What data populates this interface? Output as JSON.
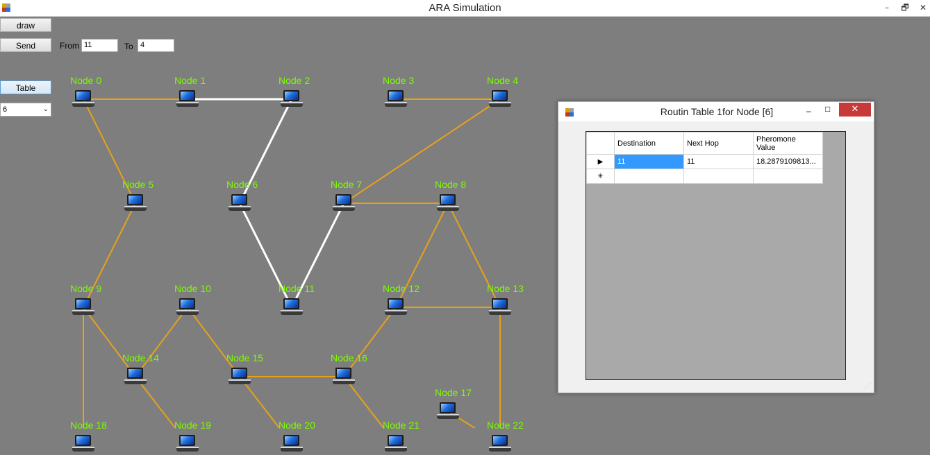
{
  "window": {
    "title": "ARA Simulation",
    "minimize": "–",
    "restore": "🗗",
    "close": "✕"
  },
  "controls": {
    "draw_label": "draw",
    "send_label": "Send",
    "from_label": "From",
    "from_value": "11",
    "to_label": "To",
    "to_value": "4",
    "table_label": "Table",
    "node_select_value": "6"
  },
  "nodes": [
    {
      "label": "Node 0"
    },
    {
      "label": "Node 1"
    },
    {
      "label": "Node 2"
    },
    {
      "label": "Node 3"
    },
    {
      "label": "Node 4"
    },
    {
      "label": "Node 5"
    },
    {
      "label": "Node 6"
    },
    {
      "label": "Node 7"
    },
    {
      "label": "Node 8"
    },
    {
      "label": "Node 9"
    },
    {
      "label": "Node 10"
    },
    {
      "label": "Node 11"
    },
    {
      "label": "Node 12"
    },
    {
      "label": "Node 13"
    },
    {
      "label": "Node 14"
    },
    {
      "label": "Node 15"
    },
    {
      "label": "Node 16"
    },
    {
      "label": "Node 17"
    },
    {
      "label": "Node 18"
    },
    {
      "label": "Node 19"
    },
    {
      "label": "Node 20"
    },
    {
      "label": "Node 21"
    },
    {
      "label": "Node 22"
    }
  ],
  "edges": [
    [
      0,
      1
    ],
    [
      1,
      2
    ],
    [
      3,
      4
    ],
    [
      0,
      5
    ],
    [
      2,
      6
    ],
    [
      4,
      7
    ],
    [
      7,
      8
    ],
    [
      5,
      9
    ],
    [
      6,
      11
    ],
    [
      7,
      11
    ],
    [
      8,
      12
    ],
    [
      8,
      13
    ],
    [
      12,
      13
    ],
    [
      9,
      14
    ],
    [
      10,
      14
    ],
    [
      9,
      18
    ],
    [
      10,
      15
    ],
    [
      15,
      16
    ],
    [
      12,
      16
    ],
    [
      14,
      19
    ],
    [
      15,
      20
    ],
    [
      16,
      21
    ],
    [
      13,
      22
    ],
    [
      17,
      22
    ]
  ],
  "path_edges": [
    [
      1,
      2
    ],
    [
      2,
      6
    ],
    [
      6,
      11
    ],
    [
      11,
      7
    ]
  ],
  "colors": {
    "edge": "#e6a21a",
    "path": "#ffffff",
    "node_label": "#7cfc00",
    "background": "#7e7e7e"
  },
  "routing_window": {
    "title": "Routin Table 1for Node [6]",
    "columns": [
      "Destination",
      "Next Hop",
      "Pheromone\nValue"
    ],
    "rows": [
      {
        "marker": "▶",
        "destination": "11",
        "next_hop": "11",
        "pheromone": "18.2879109813..."
      }
    ],
    "new_row_marker": "✳"
  }
}
